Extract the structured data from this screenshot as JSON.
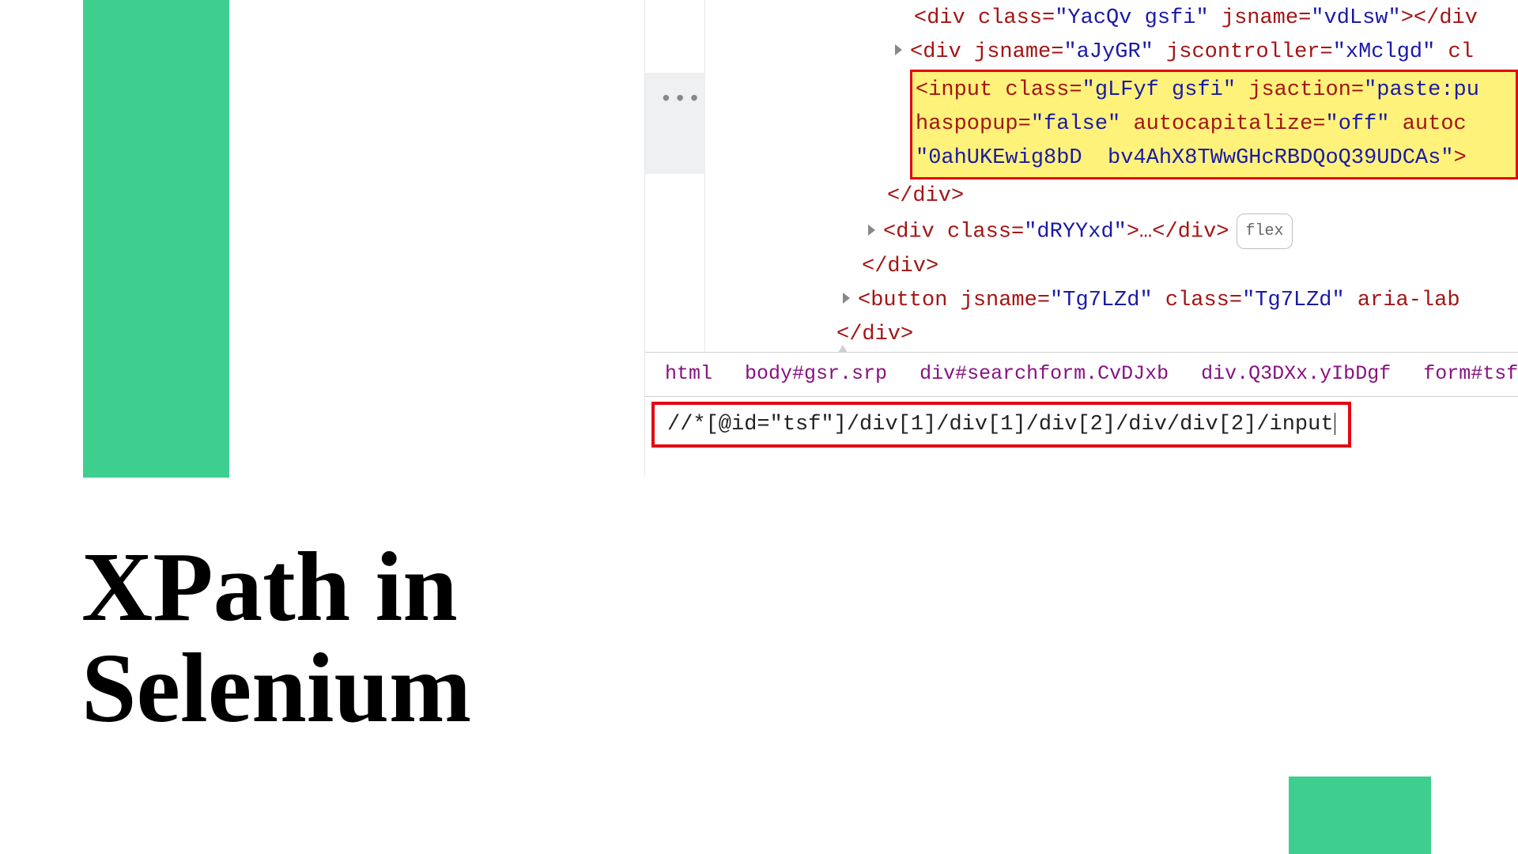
{
  "title_line1": "XPath in",
  "title_line2": "Selenium",
  "code": {
    "line1_pre": "<div class=",
    "line1_v1": "\"YacQv gsfi\"",
    "line1_a2": " jsname=",
    "line1_v2": "\"vdLsw\"",
    "line1_post": "></div",
    "line2_pre": "<div jsname=",
    "line2_v1": "\"aJyGR\"",
    "line2_a2": " jscontroller=",
    "line2_v2": "\"xMclgd\"",
    "line2_post": " cl",
    "hl1_pre": "<input class=",
    "hl1_v1": "\"gLFyf gsfi\"",
    "hl1_a2": " jsaction=",
    "hl1_v2": "\"paste:pu",
    "hl2_a1": "haspopup=",
    "hl2_v1": "\"false\"",
    "hl2_a2": " autocapitalize=",
    "hl2_v2": "\"off\"",
    "hl2_post": " autoc",
    "hl3_v": "\"0ahUKEwig8bD  bv4AhX8TWwGHcRBDQoQ39UDCAs\"",
    "hl3_post": ">",
    "close1": "</div>",
    "line_dry_pre": "<div class=",
    "line_dry_v": "\"dRYYxd\"",
    "line_dry_post": ">…</div>",
    "flex_label": "flex",
    "close2": "</div>",
    "btn_pre": "<button jsname=",
    "btn_v1": "\"Tg7LZd\"",
    "btn_a2": " class=",
    "btn_v2": "\"Tg7LZd\"",
    "btn_a3": " aria-lab",
    "close3": "</div>"
  },
  "breadcrumbs": {
    "b1": "html",
    "b2": "body#gsr.srp",
    "b3": "div#searchform.CvDJxb",
    "b4": "div.Q3DXx.yIbDgf",
    "b5": "form#tsf."
  },
  "xpath": "//*[@id=\"tsf\"]/div[1]/div[1]/div[2]/div/div[2]/input"
}
